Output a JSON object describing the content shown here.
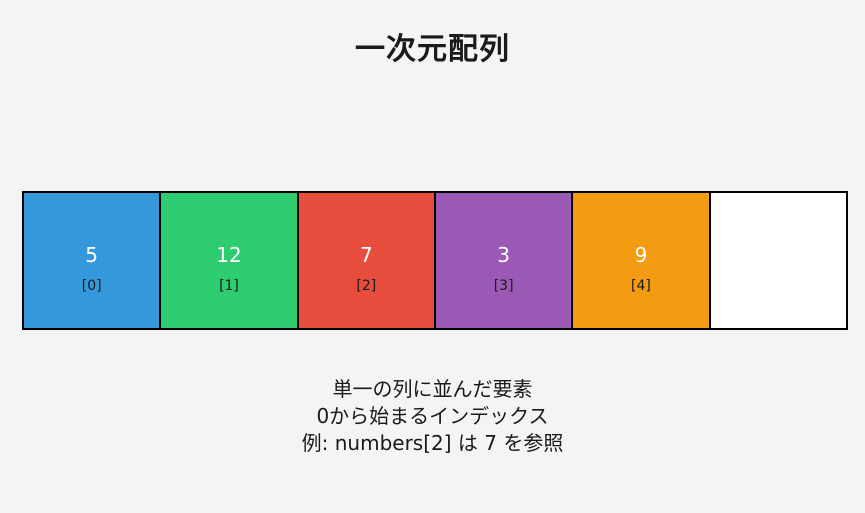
{
  "title": "一次元配列",
  "cells": [
    {
      "value": "5",
      "index": "[0]",
      "color": "#3498db"
    },
    {
      "value": "12",
      "index": "[1]",
      "color": "#2ecc71"
    },
    {
      "value": "7",
      "index": "[2]",
      "color": "#e74c3c"
    },
    {
      "value": "3",
      "index": "[3]",
      "color": "#9b59b6"
    },
    {
      "value": "9",
      "index": "[4]",
      "color": "#f39c12"
    },
    {
      "value": "",
      "index": "",
      "color": "#ffffff"
    }
  ],
  "caption": [
    "単一の列に並んだ要素",
    "0から始まるインデックス",
    "例: numbers[2] は 7 を参照"
  ]
}
